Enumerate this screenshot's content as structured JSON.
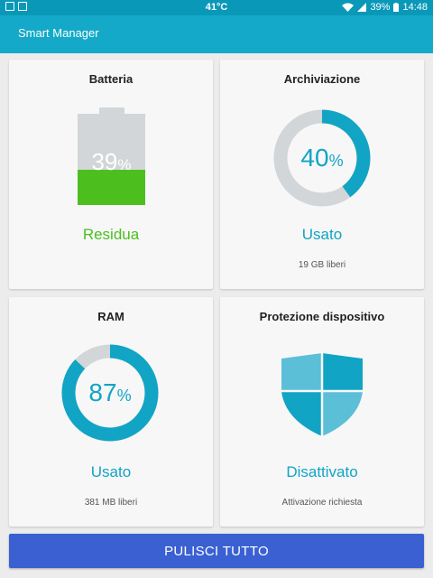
{
  "status_bar": {
    "temperature": "41°C",
    "battery": "39%",
    "time": "14:48"
  },
  "app_bar": {
    "title": "Smart Manager"
  },
  "cards": {
    "battery": {
      "title": "Batteria",
      "value": 39,
      "value_text": "39",
      "status": "Residua"
    },
    "storage": {
      "title": "Archiviazione",
      "value": 40,
      "value_text": "40",
      "status": "Usato",
      "subtitle": "19 GB liberi"
    },
    "ram": {
      "title": "RAM",
      "value": 87,
      "value_text": "87",
      "status": "Usato",
      "subtitle": "381 MB liberi"
    },
    "protection": {
      "title": "Protezione dispositivo",
      "status": "Disattivato",
      "subtitle": "Attivazione richiesta",
      "icon": "shield-icon"
    }
  },
  "percent_sign": "%",
  "clean_button": {
    "label": "PULISCI TUTTO"
  },
  "colors": {
    "accent": "#12a4c4",
    "battery_fill": "#4cbf1f",
    "battery_status": "#4cbf1f",
    "ring_track": "#d2d6d8",
    "button": "#3a60d2",
    "app_bar": "#14a9c8"
  }
}
